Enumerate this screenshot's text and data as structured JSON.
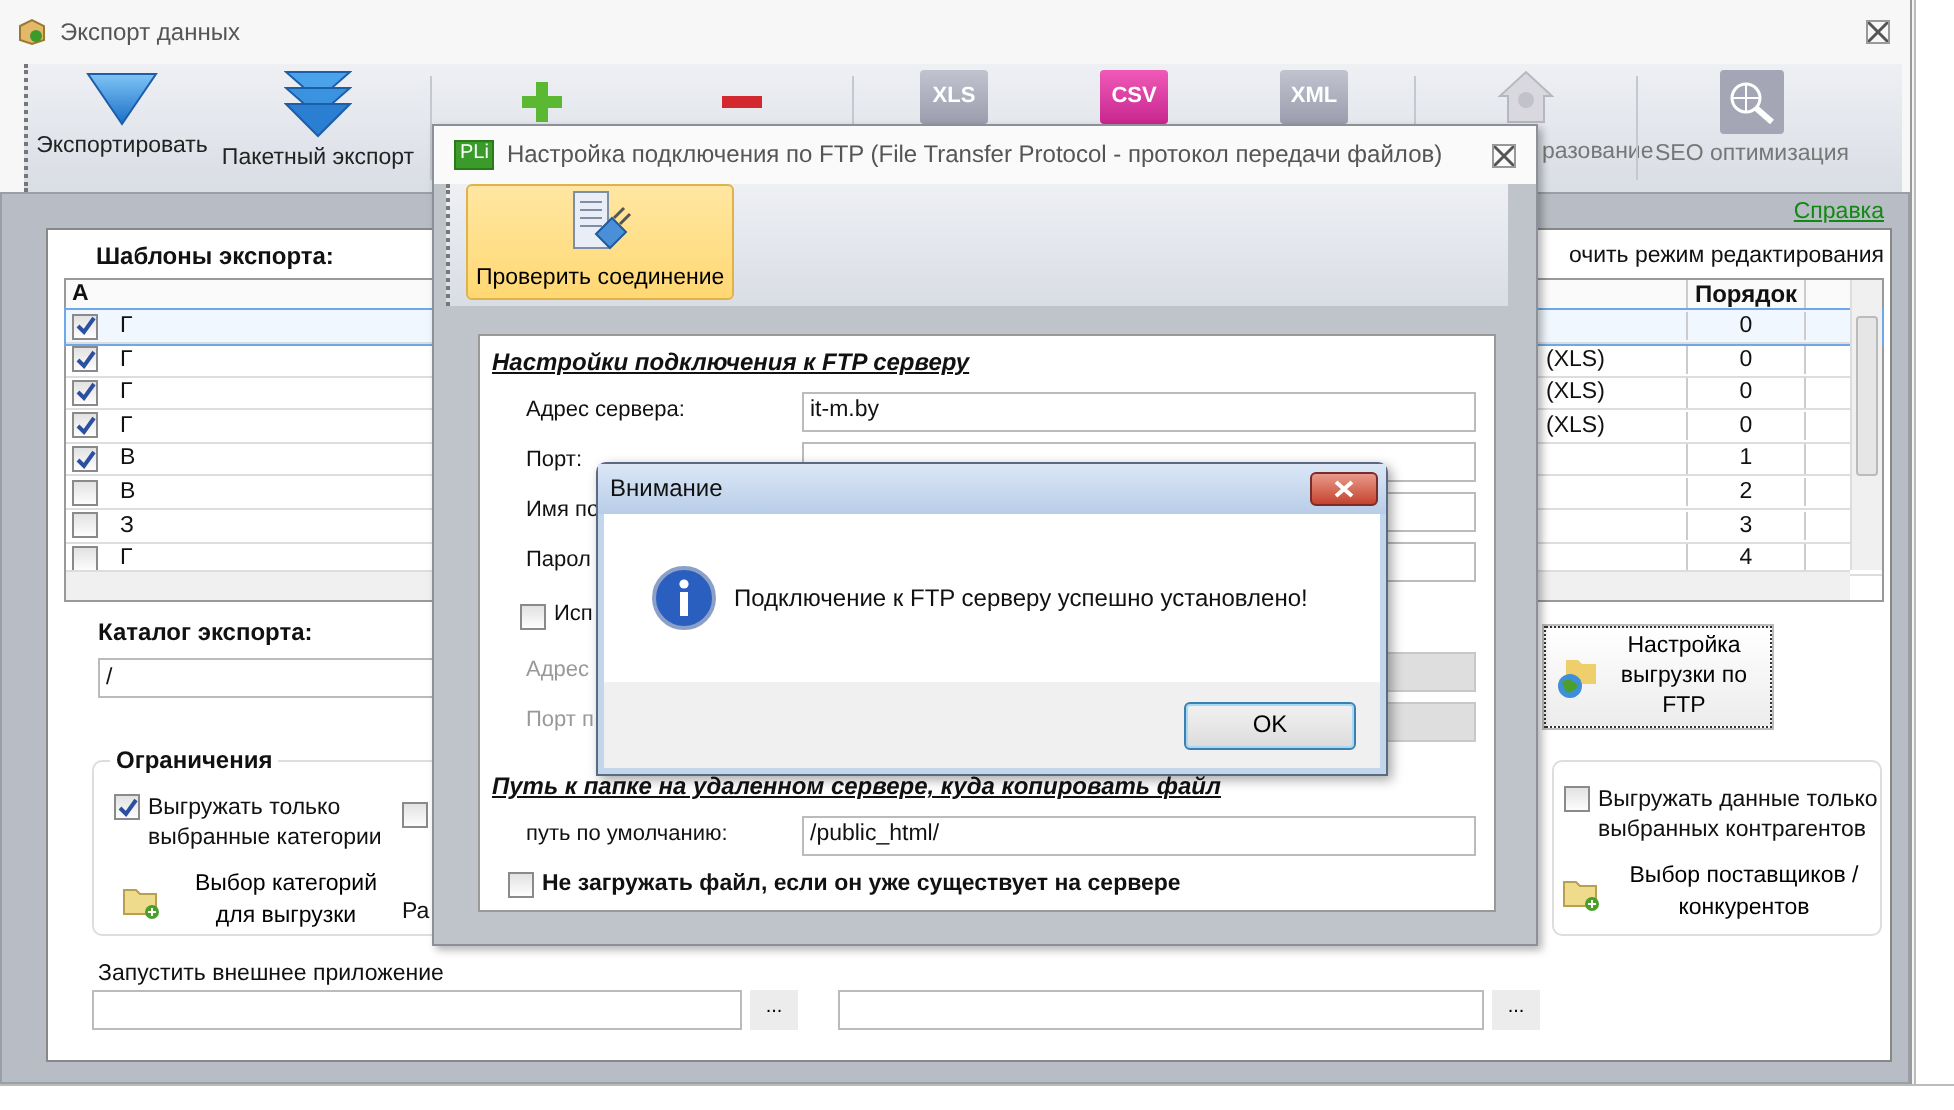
{
  "window": {
    "title": "Экспорт данных"
  },
  "toolbar": [
    {
      "kind": "arrow",
      "label": "Экспортировать"
    },
    {
      "kind": "double-arrow",
      "label": "Пакетный экспорт"
    },
    {
      "kind": "plus"
    },
    {
      "kind": "minus"
    },
    {
      "kind": "tile",
      "tile": "XLS",
      "selected": false
    },
    {
      "kind": "tile",
      "tile": "CSV",
      "selected": true
    },
    {
      "kind": "tile",
      "tile": "XML",
      "selected": false
    },
    {
      "kind": "house",
      "label": "разование"
    },
    {
      "kind": "globe",
      "label": "SEO оптимизация"
    }
  ],
  "help_link": "Справка",
  "templates": {
    "title": "Шаблоны экспорта:",
    "edit_mode_label": "очить режим редактирования",
    "columns": {
      "check": "А",
      "order": "Порядок"
    },
    "rows": [
      {
        "checked": true,
        "selected": true,
        "name": "Г",
        "column_4": "",
        "order": "0"
      },
      {
        "checked": true,
        "selected": false,
        "name": "Г",
        "column_4": "(XLS)",
        "order": "0"
      },
      {
        "checked": true,
        "selected": false,
        "name": "Г",
        "column_4": "(XLS)",
        "order": "0"
      },
      {
        "checked": true,
        "selected": false,
        "name": "Г",
        "column_4": "(XLS)",
        "order": "0"
      },
      {
        "checked": true,
        "selected": false,
        "name": "В",
        "column_4": "",
        "order": "1"
      },
      {
        "checked": false,
        "selected": false,
        "name": "В",
        "column_4": "",
        "order": "2"
      },
      {
        "checked": false,
        "selected": false,
        "name": "З",
        "column_4": "",
        "order": "3"
      },
      {
        "checked": false,
        "selected": false,
        "name": "Г",
        "column_4": "",
        "order": "4"
      }
    ]
  },
  "catalog": {
    "label": "Каталог экспорта:",
    "value": "/"
  },
  "ftp_button": "Настройка выгрузки по FTP",
  "limits": {
    "title": "Ограничения",
    "categories_checkbox": {
      "label": "Выгружать только выбранные категории",
      "checked": true
    },
    "categories_link": "Выбор категорий для выгрузки",
    "second_checkbox": {
      "checked": false
    },
    "fragment": "Ра"
  },
  "contractors": {
    "checkbox": {
      "label": "Выгружать данные только выбранных контрагентов",
      "checked": false
    },
    "link": "Выбор поставщиков / конкурентов"
  },
  "launch": {
    "label": "Запустить внешнее приложение",
    "browse": "...",
    "second_browse": "..."
  },
  "ftp_dialog": {
    "logo": "PLi",
    "title": "Настройка подключения по FTP (File Transfer Protocol - протокол передачи файлов)",
    "check_button": "Проверить соединение",
    "settings_heading": "Настройки подключения к FTP серверу",
    "rows": [
      {
        "kind": "field",
        "label": "Адрес сервера:",
        "value": "it-m.by",
        "disabled": false
      },
      {
        "kind": "field",
        "label": "Порт:",
        "disabled": false
      },
      {
        "kind": "field",
        "label": "Имя по",
        "disabled": false
      },
      {
        "kind": "field",
        "label": "Парол",
        "disabled": false
      },
      {
        "kind": "checkbox",
        "label": "Исп",
        "checked": false
      },
      {
        "kind": "field",
        "label": "Адрес",
        "disabled": true
      },
      {
        "kind": "field",
        "label": "Порт п",
        "disabled": true
      }
    ],
    "path_heading": "Путь к папке на удаленном сервере, куда копировать файл",
    "path_label": "путь по умолчанию:",
    "path_value": "/public_html/",
    "skip_existing": {
      "label": "Не загружать файл, если он уже существует на сервере",
      "checked": false
    }
  },
  "alert": {
    "title": "Внимание",
    "message": "Подключение к FTP серверу успешно установлено!",
    "ok": "OK"
  }
}
